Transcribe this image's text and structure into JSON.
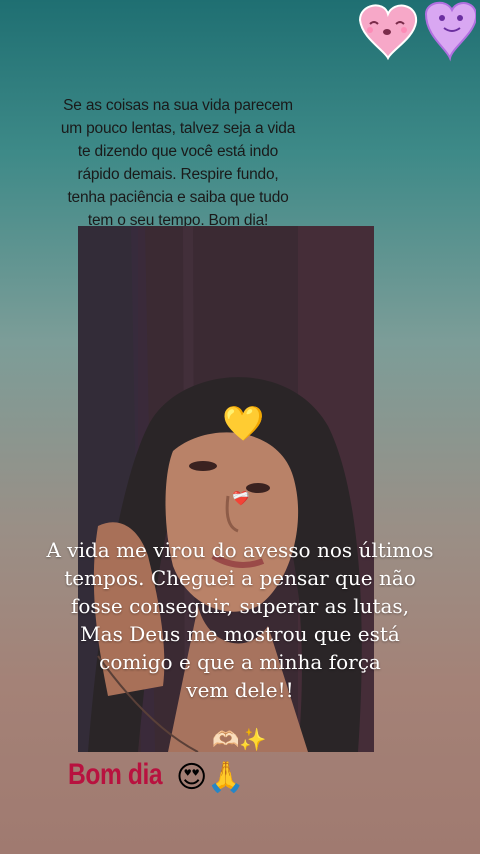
{
  "story": {
    "top_quote": "Se as coisas na sua vida parecem um pouco lentas, talvez seja a vida te dizendo que você está indo rápido demais. Respire fundo, tenha paciência e saiba que tudo tem o seu tempo. Bom dia!",
    "top_quote_lines": [
      "Se as coisas na sua vida parecem",
      "um pouco lentas, talvez seja a vida",
      "te dizendo que você está indo",
      "rápido demais. Respire fundo,",
      "tenha paciência e saiba que tudo",
      "tem o seu tempo. Bom dia!"
    ],
    "caption_lines": [
      "A vida me virou do avesso nos últimos",
      "tempos. Cheguei a pensar que não",
      "fosse conseguir, superar as lutas,",
      "Mas Deus me mostrou que está",
      "comigo e que a minha força",
      "vem dele!!"
    ],
    "caption_emojis": "🫶🏻✨",
    "bottom_text": "Bom dia",
    "bottom_emojis": "😍🙏",
    "heart_emoji": "💛",
    "small_heart_emoji": "❤️‍🩹"
  },
  "colors": {
    "bottom_text": "#b8123f",
    "caption": "#ffffff",
    "quote": "#1a1a1a"
  },
  "icons": [
    "hearts-sticker-icon",
    "heart-icon"
  ]
}
